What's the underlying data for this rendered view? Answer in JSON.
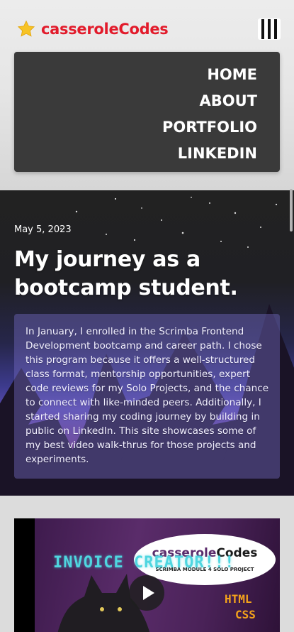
{
  "header": {
    "brand_name_part1": "casserole",
    "brand_name_part2": "Codes",
    "menu_icon": "hamburger-icon",
    "brand_icon": "star-icon"
  },
  "nav": {
    "items": [
      {
        "label": "HOME"
      },
      {
        "label": "ABOUT"
      },
      {
        "label": "PORTFOLIO"
      },
      {
        "label": "LINKEDIN"
      }
    ]
  },
  "post": {
    "date": "May 5, 2023",
    "title": "My journey as a bootcamp student.",
    "body": "In January, I enrolled in the Scrimba Frontend Development bootcamp and career path. I chose this program because it offers a well-structured class format, mentorship opportunities, expert code reviews for my Solo Projects, and the chance to connect with like-minded peers. Additionally, I started sharing my coding journey by building in public on LinkedIn. This site showcases some of my best video walk-thrus for those projects and experiments."
  },
  "video": {
    "bubble_part1": "casserole",
    "bubble_part2": "Codes",
    "bubble_sub": "SCRIMBA MODULE 4 SOLO PROJECT",
    "title": "INVOICE CREATOR!!!",
    "tech_1": "HTML",
    "tech_2": "CSS",
    "play_icon": "play-icon"
  },
  "colors": {
    "brand_red": "#e21b2b",
    "nav_bg": "#3a3a3a",
    "video_title": "#4fd6e0",
    "tech_label": "#f3a31b"
  }
}
